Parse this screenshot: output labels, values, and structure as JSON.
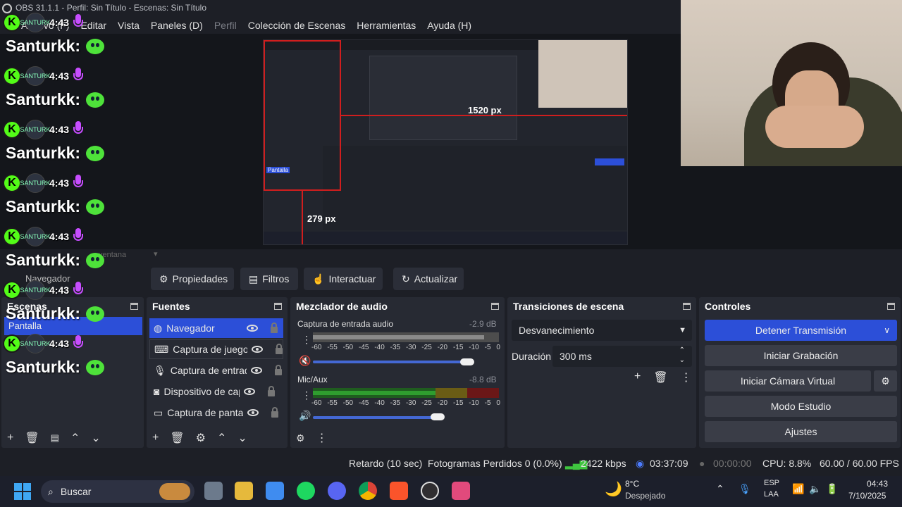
{
  "window": {
    "title": "OBS 31.1.1 - Perfil: Sin Título - Escenas: Sin Título"
  },
  "menu": [
    "Archivo (F)",
    "Editar",
    "Vista",
    "Paneles (D)",
    "Perfil",
    "Colección de Escenas",
    "Herramientas",
    "Ayuda (H)"
  ],
  "chat": {
    "messages": [
      {
        "time": "4:43",
        "user": "Santurkk:"
      },
      {
        "time": "4:43",
        "user": "Santurkk:"
      },
      {
        "time": "4:43",
        "user": "Santurkk:"
      },
      {
        "time": "4:43",
        "user": "Santurkk:"
      },
      {
        "time": "4:43",
        "user": "Santurkk:"
      },
      {
        "time": "4:43",
        "user": "Santurkk:"
      },
      {
        "time": "4:43",
        "user": "Santurkk:"
      }
    ],
    "avatar_text": "SANTURK"
  },
  "preview": {
    "dim_h": "1520 px",
    "dim_v": "279 px",
    "source_label": "Pantalla",
    "window_hint": "ventana"
  },
  "toolbar": {
    "properties": "Propiedades",
    "filters": "Filtros",
    "interact": "Interactuar",
    "refresh": "Actualizar",
    "behind_label": "Navegador"
  },
  "scenes": {
    "title": "Escenas",
    "selected": "Pantalla"
  },
  "sources": {
    "title": "Fuentes",
    "items": [
      {
        "label": "Navegador",
        "icon": "globe-icon"
      },
      {
        "label": "Captura de juego",
        "icon": "gamepad-icon"
      },
      {
        "label": "Captura de entrada de audio",
        "icon": "mic-icon"
      },
      {
        "label": "Dispositivo de captura de video",
        "icon": "camera-icon"
      },
      {
        "label": "Captura de pantalla",
        "icon": "monitor-icon"
      }
    ]
  },
  "mixer": {
    "title": "Mezclador de audio",
    "channels": [
      {
        "name": "Captura de entrada audio",
        "db": "-2.9 dB",
        "level": 0.92,
        "muted": true
      },
      {
        "name": "Mic/Aux",
        "db": "-8.8 dB",
        "level": 0.66,
        "muted": false
      }
    ],
    "scale": [
      "-60",
      "-55",
      "-50",
      "-45",
      "-40",
      "-35",
      "-30",
      "-25",
      "-20",
      "-15",
      "-10",
      "-5",
      "0"
    ]
  },
  "transitions": {
    "title": "Transiciones de escena",
    "selected": "Desvanecimiento",
    "duration_label": "Duración",
    "duration": "300 ms"
  },
  "controls": {
    "title": "Controles",
    "stop_stream": "Detener Transmisión",
    "start_recording": "Iniciar Grabación",
    "start_virtual_cam": "Iniciar Cámara Virtual",
    "studio_mode": "Modo Estudio",
    "settings": "Ajustes"
  },
  "status": {
    "delay": "Retardo (10 sec)",
    "dropped": "Fotogramas Perdidos 0 (0.0%)",
    "bitrate": "2422 kbps",
    "stream_time": "03:37:09",
    "rec_time": "00:00:00",
    "cpu": "CPU: 8.8%",
    "fps": "60.00 / 60.00 FPS"
  },
  "taskbar": {
    "search": "Buscar",
    "weather_temp": "8°C",
    "weather_desc": "Despejado",
    "lang1": "ESP",
    "lang2": "LAA",
    "time": "04:43",
    "date": "7/10/2025"
  },
  "colors": {
    "accent": "#2c4fd8",
    "kick": "#53fc18",
    "mic": "#c74dff"
  }
}
